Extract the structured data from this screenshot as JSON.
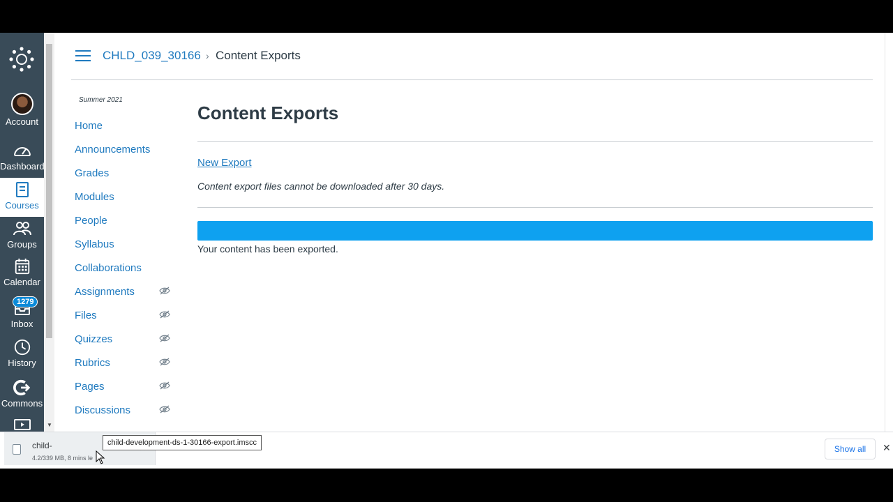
{
  "global_nav": {
    "items": [
      {
        "label": "Account",
        "icon": "avatar"
      },
      {
        "label": "Dashboard",
        "icon": "dashboard-icon"
      },
      {
        "label": "Courses",
        "icon": "courses-icon"
      },
      {
        "label": "Groups",
        "icon": "groups-icon"
      },
      {
        "label": "Calendar",
        "icon": "calendar-icon"
      },
      {
        "label": "Inbox",
        "icon": "inbox-icon"
      },
      {
        "label": "History",
        "icon": "history-icon"
      },
      {
        "label": "Commons",
        "icon": "commons-icon"
      }
    ],
    "inbox_badge": "1279",
    "colors": {
      "nav_bg": "#394b58",
      "accent": "#1f7abf"
    }
  },
  "breadcrumb": {
    "course": "CHLD_039_30166",
    "separator": "›",
    "current": "Content Exports"
  },
  "course_nav": {
    "term": "Summer 2021",
    "items": [
      {
        "label": "Home",
        "hidden_icon": false
      },
      {
        "label": "Announcements",
        "hidden_icon": false
      },
      {
        "label": "Grades",
        "hidden_icon": false
      },
      {
        "label": "Modules",
        "hidden_icon": false
      },
      {
        "label": "People",
        "hidden_icon": false
      },
      {
        "label": "Syllabus",
        "hidden_icon": false
      },
      {
        "label": "Collaborations",
        "hidden_icon": false
      },
      {
        "label": "Assignments",
        "hidden_icon": true
      },
      {
        "label": "Files",
        "hidden_icon": true
      },
      {
        "label": "Quizzes",
        "hidden_icon": true
      },
      {
        "label": "Rubrics",
        "hidden_icon": true
      },
      {
        "label": "Pages",
        "hidden_icon": true
      },
      {
        "label": "Discussions",
        "hidden_icon": true
      }
    ]
  },
  "main": {
    "title": "Content Exports",
    "new_export_link": "New Export",
    "note": "Content export files cannot be downloaded after 30 days.",
    "progress_percent": 100,
    "status": "Your content has been exported."
  },
  "download_bar": {
    "file_name": "child-",
    "status": "4.2/339 MB, 8 mins le",
    "tooltip": "child-development-ds-1-30166-export.imscc",
    "show_all": "Show all",
    "close": "✕"
  }
}
